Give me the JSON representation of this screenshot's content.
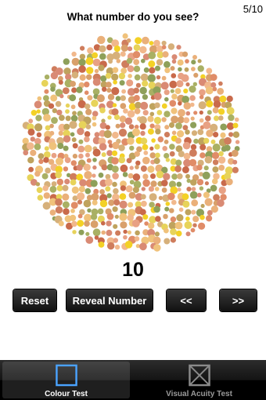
{
  "header": {
    "counter": "5/10",
    "question": "What number do you see?"
  },
  "plate": {
    "palette": [
      "#d9a06b",
      "#e08c68",
      "#c96a4b",
      "#eab07a",
      "#cf7d5d",
      "#f0c27b",
      "#e7d35a",
      "#f3d126",
      "#a9b064",
      "#8ea05a",
      "#d98a74",
      "#e8a184",
      "#bfa35e",
      "#f1b88c",
      "#d6b07a"
    ]
  },
  "answer": {
    "value": "10"
  },
  "buttons": {
    "reset": "Reset",
    "reveal": "Reveal Number",
    "prev": "<<",
    "next": ">>"
  },
  "tabbar": {
    "tabs": [
      {
        "label": "Colour Test",
        "icon": "square-outline-icon",
        "active": true
      },
      {
        "label": "Visual Acuity Test",
        "icon": "crossed-box-icon",
        "active": false
      }
    ]
  }
}
